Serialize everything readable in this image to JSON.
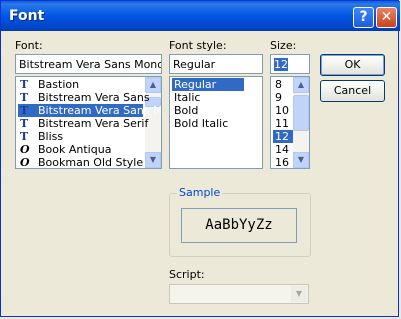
{
  "window": {
    "title": "Font",
    "help_label": "?",
    "close_label": "✕"
  },
  "font": {
    "label": "Font:",
    "value": "Bitstream Vera Sans Mono",
    "items": [
      {
        "icon": "truetype-font-icon",
        "glyph": "T",
        "name": "Bastion"
      },
      {
        "icon": "truetype-font-icon",
        "glyph": "T",
        "name": "Bitstream Vera Sans"
      },
      {
        "icon": "truetype-font-icon",
        "glyph": "T",
        "name": "Bitstream Vera Sans M"
      },
      {
        "icon": "truetype-font-icon",
        "glyph": "T",
        "name": "Bitstream Vera Serif"
      },
      {
        "icon": "truetype-font-icon",
        "glyph": "T",
        "name": "Bliss"
      },
      {
        "icon": "opentype-font-icon",
        "glyph": "O",
        "name": "Book Antiqua"
      },
      {
        "icon": "opentype-font-icon",
        "glyph": "O",
        "name": "Bookman Old Style"
      }
    ],
    "selected_index": 2
  },
  "style": {
    "label": "Font style:",
    "value": "Regular",
    "items": [
      "Regular",
      "Italic",
      "Bold",
      "Bold Italic"
    ],
    "selected_index": 0
  },
  "size": {
    "label": "Size:",
    "value": "12",
    "items": [
      "8",
      "9",
      "10",
      "11",
      "12",
      "14",
      "16"
    ],
    "selected_index": 4
  },
  "buttons": {
    "ok": "OK",
    "cancel": "Cancel"
  },
  "sample": {
    "title": "Sample",
    "text": "AaBbYyZz"
  },
  "script": {
    "label": "Script:",
    "value": ""
  },
  "icons": {
    "scroll_up": "▲",
    "scroll_down": "▼"
  }
}
